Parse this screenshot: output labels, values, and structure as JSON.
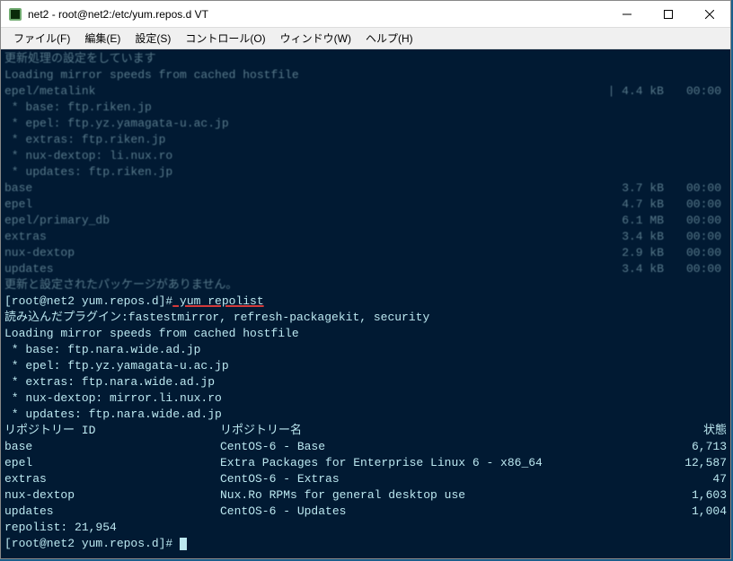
{
  "titlebar": {
    "title": "net2 - root@net2:/etc/yum.repos.d VT"
  },
  "menubar": {
    "file": "ファイル(F)",
    "edit": "編集(E)",
    "settings": "設定(S)",
    "control": "コントロール(O)",
    "window": "ウィンドウ(W)",
    "help": "ヘルプ(H)"
  },
  "faded": {
    "l1": "更新処理の設定をしています",
    "l2": "Loading mirror speeds from cached hostfile",
    "l3": "epel/metalink",
    "l3size": "| 4.4 kB",
    "l3time": "00:00",
    "l4": " * base: ftp.riken.jp",
    "l5": " * epel: ftp.yz.yamagata-u.ac.jp",
    "l6": " * extras: ftp.riken.jp",
    "l7": " * nux-dextop: li.nux.ro",
    "l8": " * updates: ftp.riken.jp",
    "r1name": "base",
    "r1size": "3.7 kB",
    "r1time": "00:00",
    "r2name": "epel",
    "r2size": "4.7 kB",
    "r2time": "00:00",
    "r3name": "epel/primary_db",
    "r3size": "6.1 MB",
    "r3time": "00:00",
    "r4name": "extras",
    "r4size": "3.4 kB",
    "r4time": "00:00",
    "r5name": "nux-dextop",
    "r5size": "2.9 kB",
    "r5time": "00:00",
    "r6name": "updates",
    "r6size": "3.4 kB",
    "r6time": "00:00",
    "l9": "更新と設定されたパッケージがありません。"
  },
  "main": {
    "prompt1": "[root@net2 yum.repos.d]#",
    "cmd": " yum repolist",
    "plugins": "読み込んだプラグイン:fastestmirror, refresh-packagekit, security",
    "loading": "Loading mirror speeds from cached hostfile",
    "mirror1": " * base: ftp.nara.wide.ad.jp",
    "mirror2": " * epel: ftp.yz.yamagata-u.ac.jp",
    "mirror3": " * extras: ftp.nara.wide.ad.jp",
    "mirror4": " * nux-dextop: mirror.li.nux.ro",
    "mirror5": " * updates: ftp.nara.wide.ad.jp",
    "header_id": "リポジトリー ID",
    "header_name": "リポジトリー名",
    "header_status": "状態",
    "repos": [
      {
        "id": "base",
        "name": "CentOS-6 - Base",
        "status": "6,713"
      },
      {
        "id": "epel",
        "name": "Extra Packages for Enterprise Linux 6 - x86_64",
        "status": "12,587"
      },
      {
        "id": "extras",
        "name": "CentOS-6 - Extras",
        "status": "47"
      },
      {
        "id": "nux-dextop",
        "name": "Nux.Ro RPMs for general desktop use",
        "status": "1,603"
      },
      {
        "id": "updates",
        "name": "CentOS-6 - Updates",
        "status": "1,004"
      }
    ],
    "repolist_total": "repolist: 21,954",
    "prompt2": "[root@net2 yum.repos.d]# "
  }
}
